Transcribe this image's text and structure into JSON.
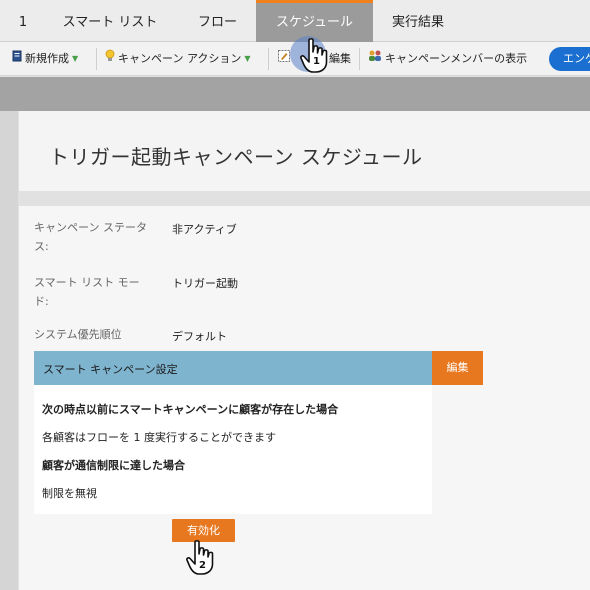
{
  "tabs": [
    {
      "label": "1",
      "active": false
    },
    {
      "label": "スマート リスト",
      "active": false
    },
    {
      "label": "フロー",
      "active": false
    },
    {
      "label": "スケジュール",
      "active": true
    },
    {
      "label": "実行結果",
      "active": false
    }
  ],
  "toolbar": {
    "new_label": "新規作成",
    "campaign_actions_label": "キャンペーン アクション",
    "edit_label": "編集",
    "show_members_label": "キャンペーンメンバーの表示",
    "engage_label": "エンゲ"
  },
  "page": {
    "title": "トリガー起動キャンペーン スケジュール"
  },
  "fields": {
    "status_label_1": "キャンペーン ステータ",
    "status_label_2": "ス:",
    "status_value": "非アクティブ",
    "mode_label_1": "スマート リスト モー",
    "mode_label_2": "ド:",
    "mode_value": "トリガー起動",
    "priority_label": "システム優先順位",
    "priority_value": "デフォルト"
  },
  "settings": {
    "title": "スマート キャンペーン設定",
    "edit_label": "編集",
    "line1": "次の時点以前にスマートキャンペーンに顧客が存在した場合",
    "line2": "各顧客はフローを 1 度実行することができます",
    "line3": "顧客が通信制限に達した場合",
    "line4": "制限を無視"
  },
  "activate_label": "有効化",
  "callouts": {
    "step1": "1",
    "step2": "2"
  },
  "colors": {
    "accent_orange": "#e8781f",
    "settings_header_blue": "#7fb4cf",
    "engage_blue": "#1a6fd1",
    "active_tab_gray": "#9b9b9b"
  }
}
